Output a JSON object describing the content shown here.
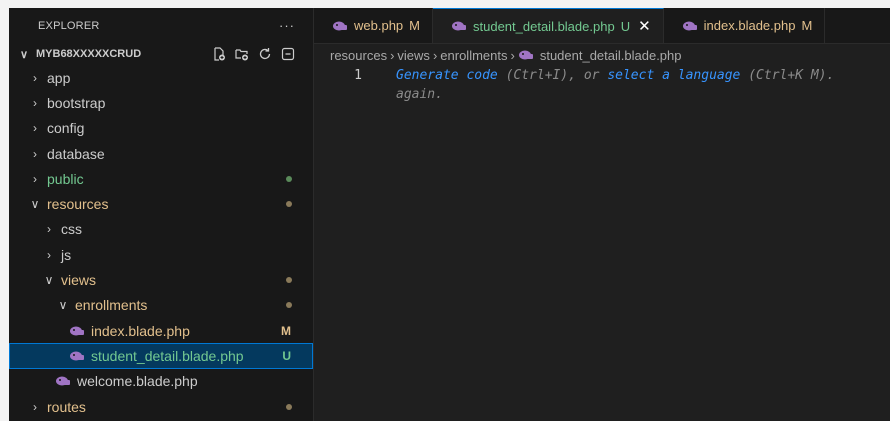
{
  "explorer": {
    "title": "EXPLORER",
    "more": "···",
    "project": "MYB68XXXXXCRUD",
    "rows": [
      {
        "label": "app",
        "level": 0,
        "kind": "folder",
        "open": false
      },
      {
        "label": "bootstrap",
        "level": 0,
        "kind": "folder",
        "open": false
      },
      {
        "label": "config",
        "level": 0,
        "kind": "folder",
        "open": false
      },
      {
        "label": "database",
        "level": 0,
        "kind": "folder",
        "open": false
      },
      {
        "label": "public",
        "level": 0,
        "kind": "folder",
        "open": false,
        "status": "dot-green"
      },
      {
        "label": "resources",
        "level": 0,
        "kind": "folder",
        "open": true,
        "status": "dot"
      },
      {
        "label": "css",
        "level": 1,
        "kind": "folder",
        "open": false
      },
      {
        "label": "js",
        "level": 1,
        "kind": "folder",
        "open": false
      },
      {
        "label": "views",
        "level": 1,
        "kind": "folder",
        "open": true,
        "status": "dot"
      },
      {
        "label": "enrollments",
        "level": 2,
        "kind": "folder",
        "open": true,
        "status": "dot"
      },
      {
        "label": "index.blade.php",
        "level": 3,
        "kind": "php",
        "badge": "M"
      },
      {
        "label": "student_detail.blade.php",
        "level": 3,
        "kind": "php",
        "badge": "U",
        "selected": true
      },
      {
        "label": "welcome.blade.php",
        "level": 2,
        "kind": "php"
      },
      {
        "label": "routes",
        "level": 0,
        "kind": "folder",
        "open": false,
        "status": "dot"
      }
    ]
  },
  "tabs": [
    {
      "label": "web.php",
      "mark": "M",
      "state": "m",
      "active": false
    },
    {
      "label": "student_detail.blade.php",
      "mark": "U",
      "state": "u",
      "active": true,
      "close": "✕"
    },
    {
      "label": "index.blade.php",
      "mark": "M",
      "state": "m",
      "active": false
    }
  ],
  "breadcrumb": [
    "resources",
    "views",
    "enrollments",
    "student_detail.blade.php"
  ],
  "editor": {
    "line_number": "1",
    "hint_generate": "Generate code",
    "hint_part1": " (Ctrl+I), or ",
    "hint_select": "select a language",
    "hint_part2": " (Ctrl+K M).",
    "hint_line2": "again."
  },
  "colors": {
    "modified": "#e2c08d",
    "untracked": "#73c991",
    "accent": "#0078d4",
    "php_icon": "#a074c4"
  }
}
